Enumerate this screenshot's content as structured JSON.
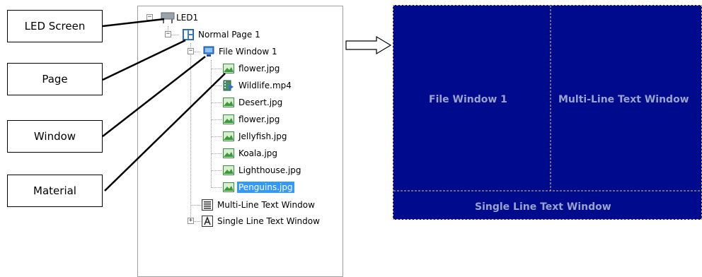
{
  "callouts": {
    "led_screen": "LED Screen",
    "page": "Page",
    "window": "Window",
    "material": "Material"
  },
  "tree": {
    "root": "LED1",
    "page": "Normal Page 1",
    "file_window": "File Window 1",
    "materials": [
      "flower.jpg",
      "Wildlife.mp4",
      "Desert.jpg",
      "flower.jpg",
      "Jellyfish.jpg",
      "Koala.jpg",
      "Lighthouse.jpg",
      "Penguins.jpg"
    ],
    "selected_material": "Penguins.jpg",
    "multi_line_window": "Multi-Line Text Window",
    "single_line_window": "Single Line Text Window"
  },
  "preview": {
    "file_window": "File Window 1",
    "multi_line_window": "Multi-Line Text Window",
    "single_line_window": "Single Line Text Window",
    "background_color": "#000a8c",
    "border_color": "#d9c56b"
  }
}
